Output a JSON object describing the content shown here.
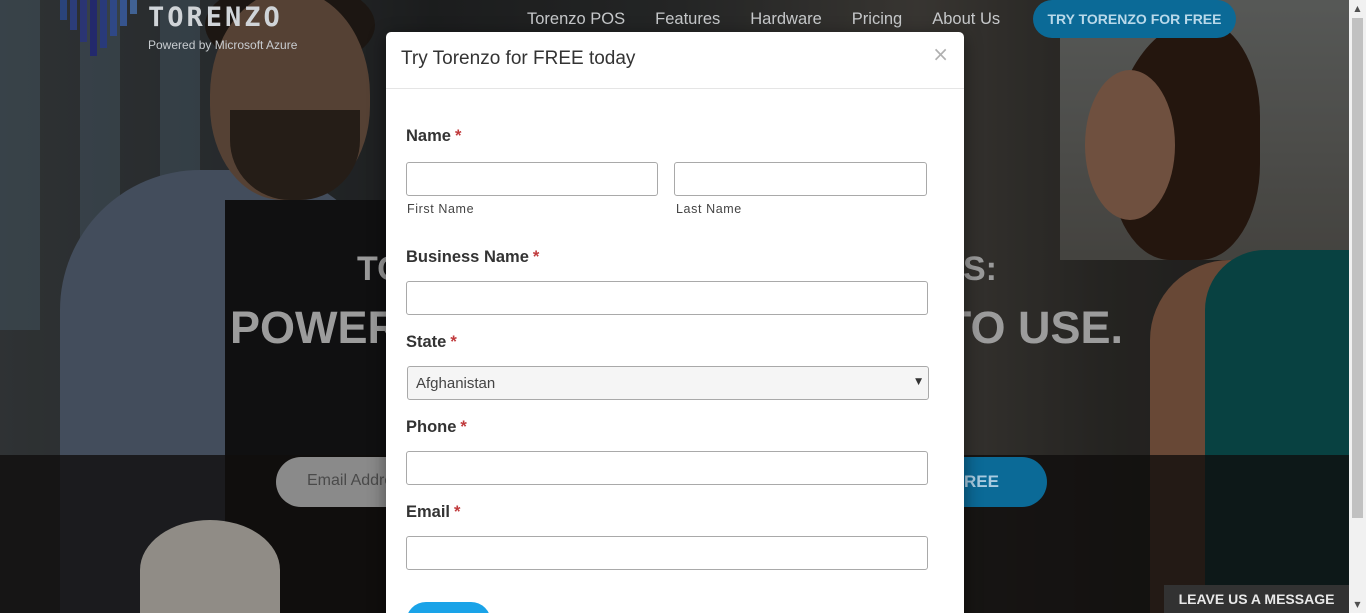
{
  "header": {
    "logo_text": "TORENZO",
    "logo_subtitle": "Powered by Microsoft Azure",
    "nav": [
      {
        "label": "Torenzo POS"
      },
      {
        "label": "Features"
      },
      {
        "label": "Hardware"
      },
      {
        "label": "Pricing"
      },
      {
        "label": "About Us"
      }
    ],
    "cta_label": "TRY TORENZO FOR FREE"
  },
  "hero": {
    "line1_left": "TO",
    "line1_right": "S:",
    "line2_left": "POWER",
    "line2_right": "TO USE.",
    "email_placeholder": "Email Addre",
    "button_label": "REE"
  },
  "modal": {
    "title": "Try Torenzo for FREE today",
    "close_glyph": "×",
    "required_marker": "*",
    "fields": {
      "name_label": "Name",
      "first_name_sublabel": "First Name",
      "last_name_sublabel": "Last Name",
      "business_label": "Business Name",
      "state_label": "State",
      "state_value": "Afghanistan",
      "phone_label": "Phone",
      "email_label": "Email"
    }
  },
  "chat": {
    "label": "LEAVE US A MESSAGE"
  },
  "icons": {
    "close": "close-icon",
    "caret": "chevron-down-icon",
    "logo": "torenzo-logo-icon"
  },
  "colors": {
    "brand_blue": "#1aa3e8",
    "cta_blue": "#0b6a97",
    "required_red": "#c0393b"
  }
}
